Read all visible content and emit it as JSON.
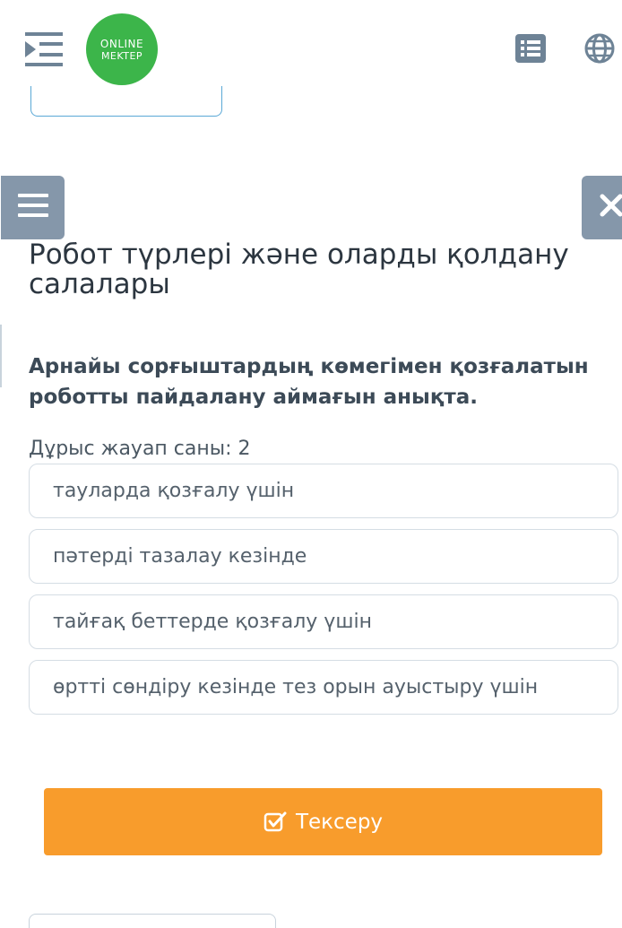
{
  "header": {
    "logo_line1": "ONLINE",
    "logo_line2": "MEKTEP",
    "brand_color": "#3cb54a",
    "icons": [
      "menu-toggle-icon",
      "list-icon",
      "globe-icon"
    ]
  },
  "side_tabs": {
    "left_icon": "hamburger-icon",
    "right_icon": "close-icon",
    "color": "#8597aa"
  },
  "lesson": {
    "title": "Робот түрлері және оларды қолдану салалары"
  },
  "question": {
    "text": "Арнайы сорғыштардың көмегімен қозғалатын роботты пайдалану аймағын анықта.",
    "answer_count_label": "Дұрыс жауап саны: 2",
    "options": [
      {
        "label": "тауларда қозғалу үшін"
      },
      {
        "label": "пәтерді тазалау кезінде"
      },
      {
        "label": "тайғақ беттерде қозғалу үшін"
      },
      {
        "label": "өртті сөндіру кезінде тез орын ауыстыру үшін"
      }
    ]
  },
  "actions": {
    "check_label": "Тексеру",
    "check_color": "#f89c2c"
  }
}
